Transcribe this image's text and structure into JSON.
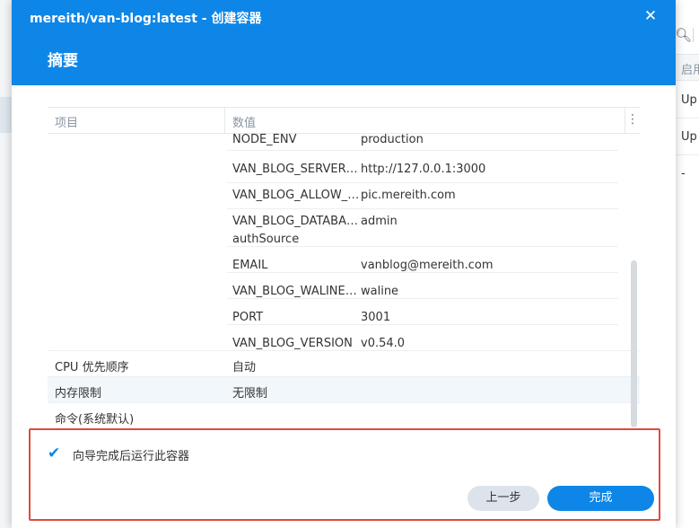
{
  "background": {
    "search_icon": "search-icon",
    "header_cell": "启用",
    "cells": [
      "Up",
      "Up",
      "-"
    ]
  },
  "dialog": {
    "title": "mereith/van-blog:latest - 创建容器",
    "subtitle": "摘要",
    "close_icon": "close-icon"
  },
  "table": {
    "columns": [
      "项目",
      "数值"
    ],
    "env_rows": [
      {
        "key": "NODE_ENV",
        "key2": "",
        "value": "production"
      },
      {
        "key": "VAN_BLOG_SERVER_URL",
        "key2": "",
        "value": "http://127.0.0.1:3000"
      },
      {
        "key": "VAN_BLOG_ALLOW_DOMAINS",
        "key2": "",
        "value": "pic.mereith.com"
      },
      {
        "key": "VAN_BLOG_DATABASE_URL",
        "key2": "authSource",
        "value": "admin"
      },
      {
        "key": "EMAIL",
        "key2": "",
        "value": "vanblog@mereith.com"
      },
      {
        "key": "VAN_BLOG_WALINE_DB",
        "key2": "",
        "value": "waline"
      },
      {
        "key": "PORT",
        "key2": "",
        "value": "3001"
      },
      {
        "key": "VAN_BLOG_VERSION",
        "key2": "",
        "value": "v0.54.0"
      }
    ],
    "rows": [
      {
        "item": "CPU 优先顺序",
        "value": "自动"
      },
      {
        "item": "内存限制",
        "value": "无限制"
      },
      {
        "item": "命令(系统默认)",
        "value": ""
      }
    ]
  },
  "footer": {
    "checkbox_label": "向导完成后运行此容器",
    "checkbox_checked": true,
    "prev_label": "上一步",
    "finish_label": "完成"
  },
  "colors": {
    "accent": "#0d86e7",
    "highlight_border": "#e04a3f"
  }
}
